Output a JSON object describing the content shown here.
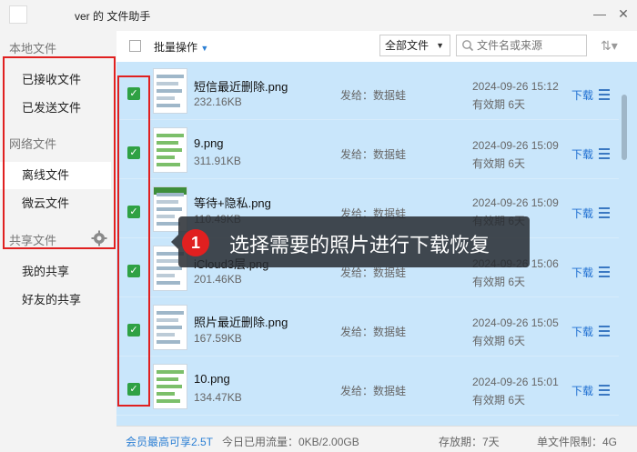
{
  "window": {
    "title_partial": "ver 的 文件助手",
    "minimize_icon": "minimize-icon",
    "close_icon": "close-icon"
  },
  "sidebar": {
    "local_group": "本地文件",
    "local_items": [
      "已接收文件",
      "已发送文件"
    ],
    "network_group": "网络文件",
    "network_items": [
      "离线文件",
      "微云文件"
    ],
    "share_group": "共享文件",
    "share_items": [
      "我的共享",
      "好友的共享"
    ],
    "active_item": "离线文件"
  },
  "toolbar": {
    "batch_label": "批量操作",
    "filter_value": "全部文件",
    "search_placeholder": "文件名或来源"
  },
  "files": [
    {
      "name": "短信最近删除.png",
      "size": "232.16KB",
      "sender": "发给：数据蛙",
      "date": "2024-09-26 15:12",
      "expiry": "有效期 6天",
      "download": "下载"
    },
    {
      "name": "9.png",
      "size": "311.91KB",
      "sender": "发给：数据蛙",
      "date": "2024-09-26 15:09",
      "expiry": "有效期 6天",
      "download": "下载"
    },
    {
      "name": "等待+隐私.png",
      "size": "110.49KB",
      "sender": "发给：数据蛙",
      "date": "2024-09-26 15:09",
      "expiry": "有效期 6天",
      "download": "下载"
    },
    {
      "name": "iCloud3层.png",
      "size": "201.46KB",
      "sender": "发给：数据蛙",
      "date": "2024-09-26 15:06",
      "expiry": "有效期 6天",
      "download": "下载"
    },
    {
      "name": "照片最近删除.png",
      "size": "167.59KB",
      "sender": "发给：数据蛙",
      "date": "2024-09-26 15:05",
      "expiry": "有效期 6天",
      "download": "下载"
    },
    {
      "name": "10.png",
      "size": "134.47KB",
      "sender": "发给：数据蛙",
      "date": "2024-09-26 15:01",
      "expiry": "有效期 6天",
      "download": "下载"
    }
  ],
  "tooltip": {
    "number": "1",
    "text": "选择需要的照片进行下载恢复"
  },
  "footer": {
    "member": "会员最高可享2.5T",
    "usage": "今日已用流量：0KB/2.00GB",
    "storage": "存放期：7天",
    "limit": "单文件限制：4G"
  },
  "colors": {
    "list_background": "#c9e6fb",
    "checkbox_checked": "#2fa144",
    "highlight_border": "#e02020",
    "link": "#1f6fd1"
  }
}
